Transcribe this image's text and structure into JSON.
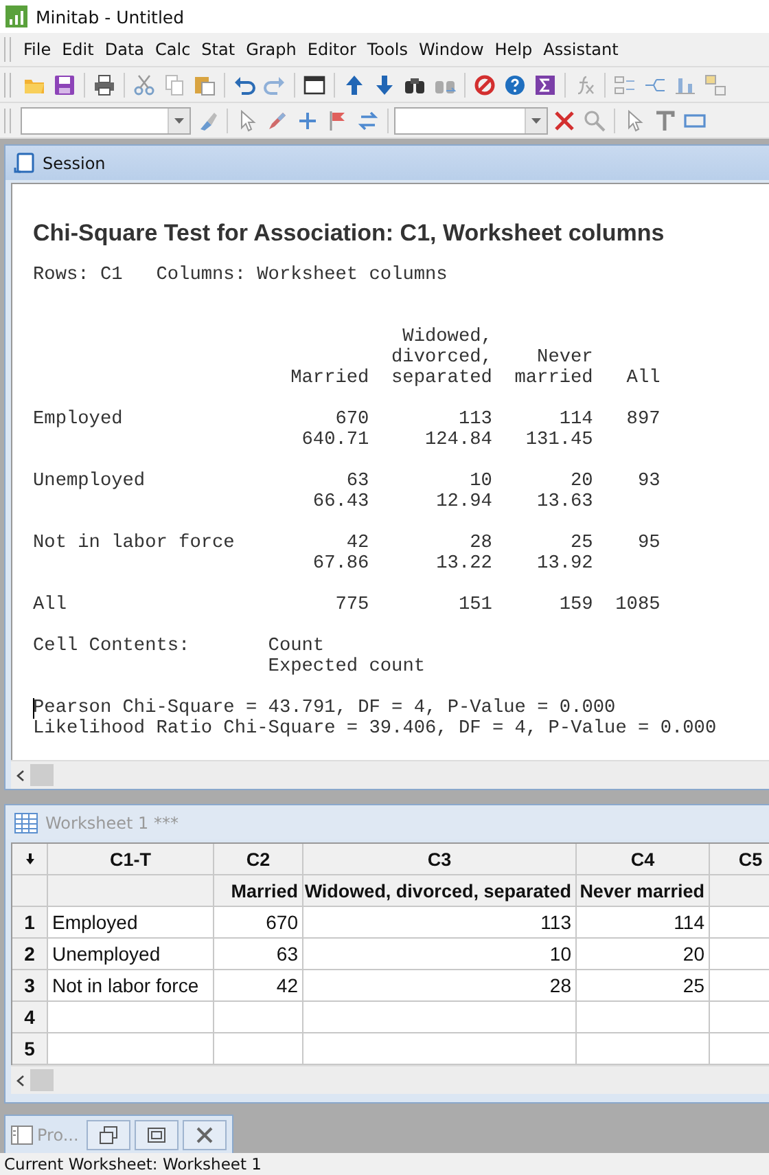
{
  "window": {
    "title": "Minitab - Untitled"
  },
  "menu": [
    "File",
    "Edit",
    "Data",
    "Calc",
    "Stat",
    "Graph",
    "Editor",
    "Tools",
    "Window",
    "Help",
    "Assistant"
  ],
  "session": {
    "title": "Session",
    "heading": "Chi-Square Test for Association: C1, Worksheet columns",
    "spec_line": "Rows: C1   Columns: Worksheet columns",
    "columns": [
      [
        "",
        "",
        "Married"
      ],
      [
        "",
        "Widowed,",
        "divorced,",
        "separated"
      ],
      [
        "",
        "Never",
        "married"
      ],
      [
        "",
        "All"
      ]
    ],
    "rows": [
      {
        "label": "Employed",
        "observed": [
          "670",
          "113",
          "114",
          "897"
        ],
        "expected": [
          "640.71",
          "124.84",
          "131.45"
        ]
      },
      {
        "label": "Unemployed",
        "observed": [
          "63",
          "10",
          "20",
          "93"
        ],
        "expected": [
          "66.43",
          "12.94",
          "13.63"
        ]
      },
      {
        "label": "Not in labor force",
        "observed": [
          "42",
          "28",
          "25",
          "95"
        ],
        "expected": [
          "67.86",
          "13.22",
          "13.92"
        ]
      },
      {
        "label": "All",
        "observed": [
          "775",
          "151",
          "159",
          "1085"
        ]
      }
    ],
    "cell_contents": {
      "label": "Cell Contents:",
      "items": [
        "Count",
        "Expected count"
      ]
    },
    "results": [
      "Pearson Chi-Square = 43.791, DF = 4, P-Value = 0.000",
      "Likelihood Ratio Chi-Square = 39.406, DF = 4, P-Value = 0.000"
    ]
  },
  "worksheet": {
    "title": "Worksheet 1 ***",
    "columns": [
      {
        "id": "C1-T"
      },
      {
        "id": "C2",
        "name": "Married"
      },
      {
        "id": "C3",
        "name": "Widowed, divorced, separated"
      },
      {
        "id": "C4",
        "name": "Never married"
      },
      {
        "id": "C5"
      }
    ],
    "rows": [
      {
        "number": "1",
        "cells": [
          "Employed",
          "670",
          "113",
          "114"
        ]
      },
      {
        "number": "2",
        "cells": [
          "Unemployed",
          "63",
          "10",
          "20"
        ]
      },
      {
        "number": "3",
        "cells": [
          "Not in labor force",
          "42",
          "28",
          "25"
        ]
      },
      {
        "number": "4"
      },
      {
        "number": "5"
      }
    ]
  },
  "minimized": {
    "title": "Pro..."
  },
  "status_bar": "Current Worksheet: Worksheet 1"
}
